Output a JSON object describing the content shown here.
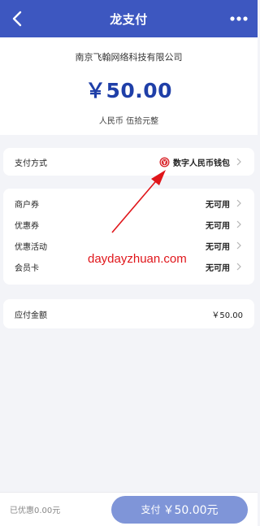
{
  "nav": {
    "title": "龙支付",
    "back_icon": "chevron-left-icon",
    "more_icon": "more-dots-icon"
  },
  "header": {
    "merchant": "南京飞翰网络科技有限公司",
    "amount": "￥50.00",
    "amount_cn": "人民币 伍拾元整"
  },
  "payment_method": {
    "label": "支付方式",
    "value": "数字人民币钱包",
    "icon": "ecny-icon"
  },
  "discounts": [
    {
      "label": "商户券",
      "value": "无可用"
    },
    {
      "label": "优惠券",
      "value": "无可用"
    },
    {
      "label": "优惠活动",
      "value": "无可用"
    },
    {
      "label": "会员卡",
      "value": "无可用"
    }
  ],
  "due": {
    "label": "应付金额",
    "value": "￥50.00"
  },
  "watermark": "daydayzhuan.com",
  "footer": {
    "saved": "已优惠0.00元",
    "pay_label": "支付",
    "pay_amount": "￥50.00元"
  },
  "colors": {
    "nav": "#3d57c0",
    "amount": "#1f3fa8",
    "button": "#7f95d8",
    "annotation": "#e0151a"
  }
}
